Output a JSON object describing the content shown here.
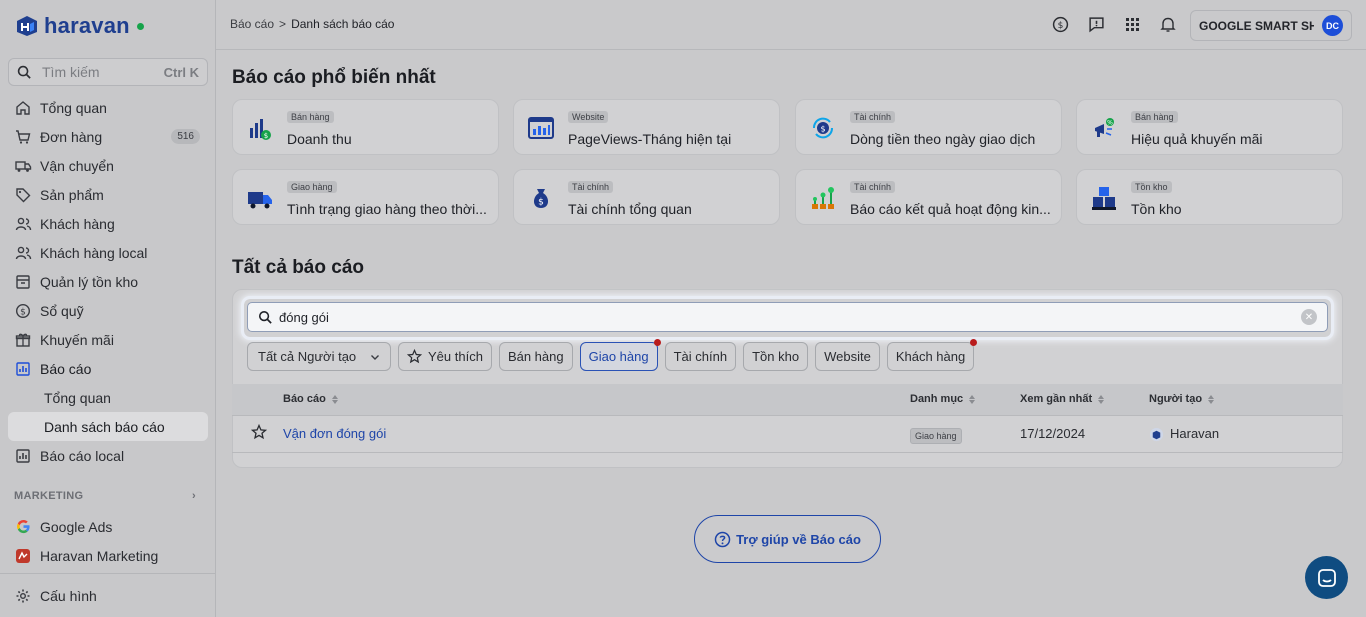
{
  "app": {
    "brand": "haravan"
  },
  "sidebar": {
    "search_placeholder": "Tìm kiếm",
    "search_shortcut": "Ctrl K",
    "items": [
      {
        "label": "Tổng quan",
        "icon": "home-icon"
      },
      {
        "label": "Đơn hàng",
        "icon": "cart-icon",
        "badge": "516"
      },
      {
        "label": "Vận chuyển",
        "icon": "truck-icon"
      },
      {
        "label": "Sản phẩm",
        "icon": "tag-icon"
      },
      {
        "label": "Khách hàng",
        "icon": "users-icon"
      },
      {
        "label": "Khách hàng local",
        "icon": "users-icon"
      },
      {
        "label": "Quản lý tồn kho",
        "icon": "box-icon"
      },
      {
        "label": "Sổ quỹ",
        "icon": "dollar-icon"
      },
      {
        "label": "Khuyến mãi",
        "icon": "gift-icon"
      },
      {
        "label": "Báo cáo",
        "icon": "chart-icon"
      }
    ],
    "sub_items": [
      {
        "label": "Tổng quan"
      },
      {
        "label": "Danh sách báo cáo"
      }
    ],
    "after_items": [
      {
        "label": "Báo cáo local",
        "icon": "chart-icon"
      }
    ],
    "marketing_label": "MARKETING",
    "marketing_items": [
      {
        "label": "Google Ads",
        "icon": "google-icon"
      },
      {
        "label": "Haravan Marketing",
        "icon": "haravan-marketing-icon"
      }
    ],
    "settings_label": "Cấu hình"
  },
  "topbar": {
    "breadcrumb_parent": "Báo cáo",
    "breadcrumb_sep": ">",
    "breadcrumb_current": "Danh sách báo cáo",
    "store_name": "GOOGLE SMART SH...",
    "avatar_initials": "DC"
  },
  "popular": {
    "title": "Báo cáo phổ biến nhất",
    "cards": [
      {
        "tag": "Bán hàng",
        "title": "Doanh thu",
        "icon": "revenue-chart-icon"
      },
      {
        "tag": "Website",
        "title": "PageViews-Tháng hiện tại",
        "icon": "web-chart-icon"
      },
      {
        "tag": "Tài chính",
        "title": "Dòng tiền theo ngày giao dịch",
        "icon": "cashflow-icon"
      },
      {
        "tag": "Bán hàng",
        "title": "Hiệu quả khuyến mãi",
        "icon": "megaphone-icon"
      },
      {
        "tag": "Giao hàng",
        "title": "Tình trạng giao hàng theo thời...",
        "icon": "delivery-truck-icon"
      },
      {
        "tag": "Tài chính",
        "title": "Tài chính tổng quan",
        "icon": "money-bag-icon"
      },
      {
        "tag": "Tài chính",
        "title": "Báo cáo kết quả hoạt động kin...",
        "icon": "growth-plant-icon"
      },
      {
        "tag": "Tồn kho",
        "title": "Tồn kho",
        "icon": "inventory-boxes-icon"
      }
    ]
  },
  "all_reports": {
    "title": "Tất cả báo cáo",
    "search_value": "đóng gói",
    "creator_filter": "Tất cả Người tạo",
    "filters": [
      {
        "label": "Yêu thích"
      },
      {
        "label": "Bán hàng"
      },
      {
        "label": "Giao hàng"
      },
      {
        "label": "Tài chính"
      },
      {
        "label": "Tồn kho"
      },
      {
        "label": "Website"
      },
      {
        "label": "Khách hàng"
      }
    ],
    "columns": {
      "report": "Báo cáo",
      "category": "Danh mục",
      "last_viewed": "Xem gần nhất",
      "creator": "Người tạo"
    },
    "rows": [
      {
        "report": "Vận đơn đóng gói",
        "category": "Giao hàng",
        "last_viewed": "17/12/2024",
        "creator": "Haravan"
      }
    ]
  },
  "help_button": "Trợ giúp về Báo cáo",
  "colors": {
    "accent": "#1e45a8",
    "brand": "#1f3f8f",
    "dot_alert": "#b91c1c"
  }
}
